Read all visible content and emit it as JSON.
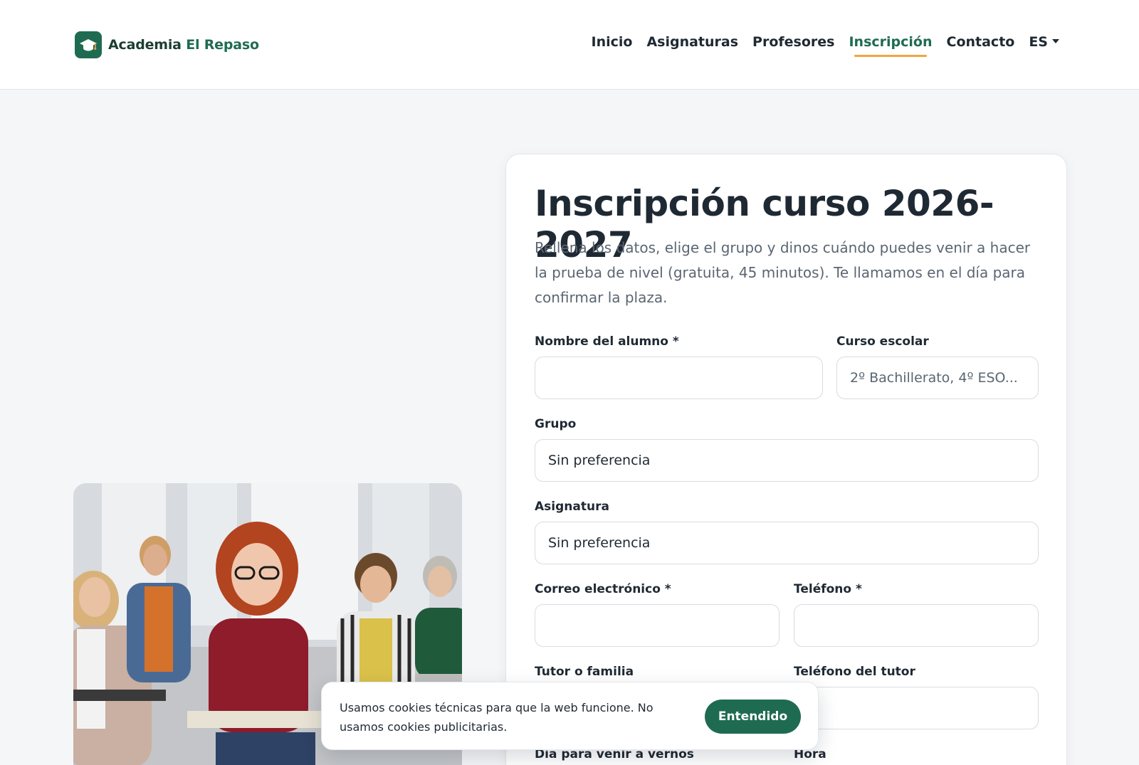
{
  "brand": {
    "name_primary": "Academia",
    "name_secondary": "El Repaso"
  },
  "nav": {
    "items": [
      {
        "label": "Inicio"
      },
      {
        "label": "Asignaturas"
      },
      {
        "label": "Profesores"
      },
      {
        "label": "Inscripción",
        "active": true
      },
      {
        "label": "Contacto"
      }
    ],
    "lang": "ES"
  },
  "form": {
    "title": "Inscripción curso 2026-2027",
    "subtitle": "Rellena los datos, elige el grupo y dinos cuándo puedes venir a hacer la prueba de nivel (gratuita, 45 minutos). Te llamamos en el día para confirmar la plaza.",
    "student_name": {
      "label": "Nombre del alumno *",
      "value": "",
      "placeholder": ""
    },
    "school_year": {
      "label": "Curso escolar",
      "value": "",
      "placeholder": "2º Bachillerato, 4º ESO..."
    },
    "group": {
      "label": "Grupo",
      "selected": "Sin preferencia"
    },
    "subject": {
      "label": "Asignatura",
      "selected": "Sin preferencia"
    },
    "email": {
      "label": "Correo electrónico *",
      "value": ""
    },
    "phone": {
      "label": "Teléfono *",
      "value": ""
    },
    "guardian": {
      "label": "Tutor o familia",
      "value": ""
    },
    "guardian_phone": {
      "label": "Teléfono del tutor",
      "value": ""
    },
    "visit_day": {
      "label": "Día para venir a vernos"
    },
    "visit_time": {
      "label": "Hora"
    }
  },
  "cookie": {
    "text": "Usamos cookies técnicas para que la web funcione. No usamos cookies publicitarias.",
    "button": "Entendido"
  },
  "colors": {
    "brand": "#1f6b52",
    "accent": "#f2a541",
    "background": "#f5f6f8"
  }
}
